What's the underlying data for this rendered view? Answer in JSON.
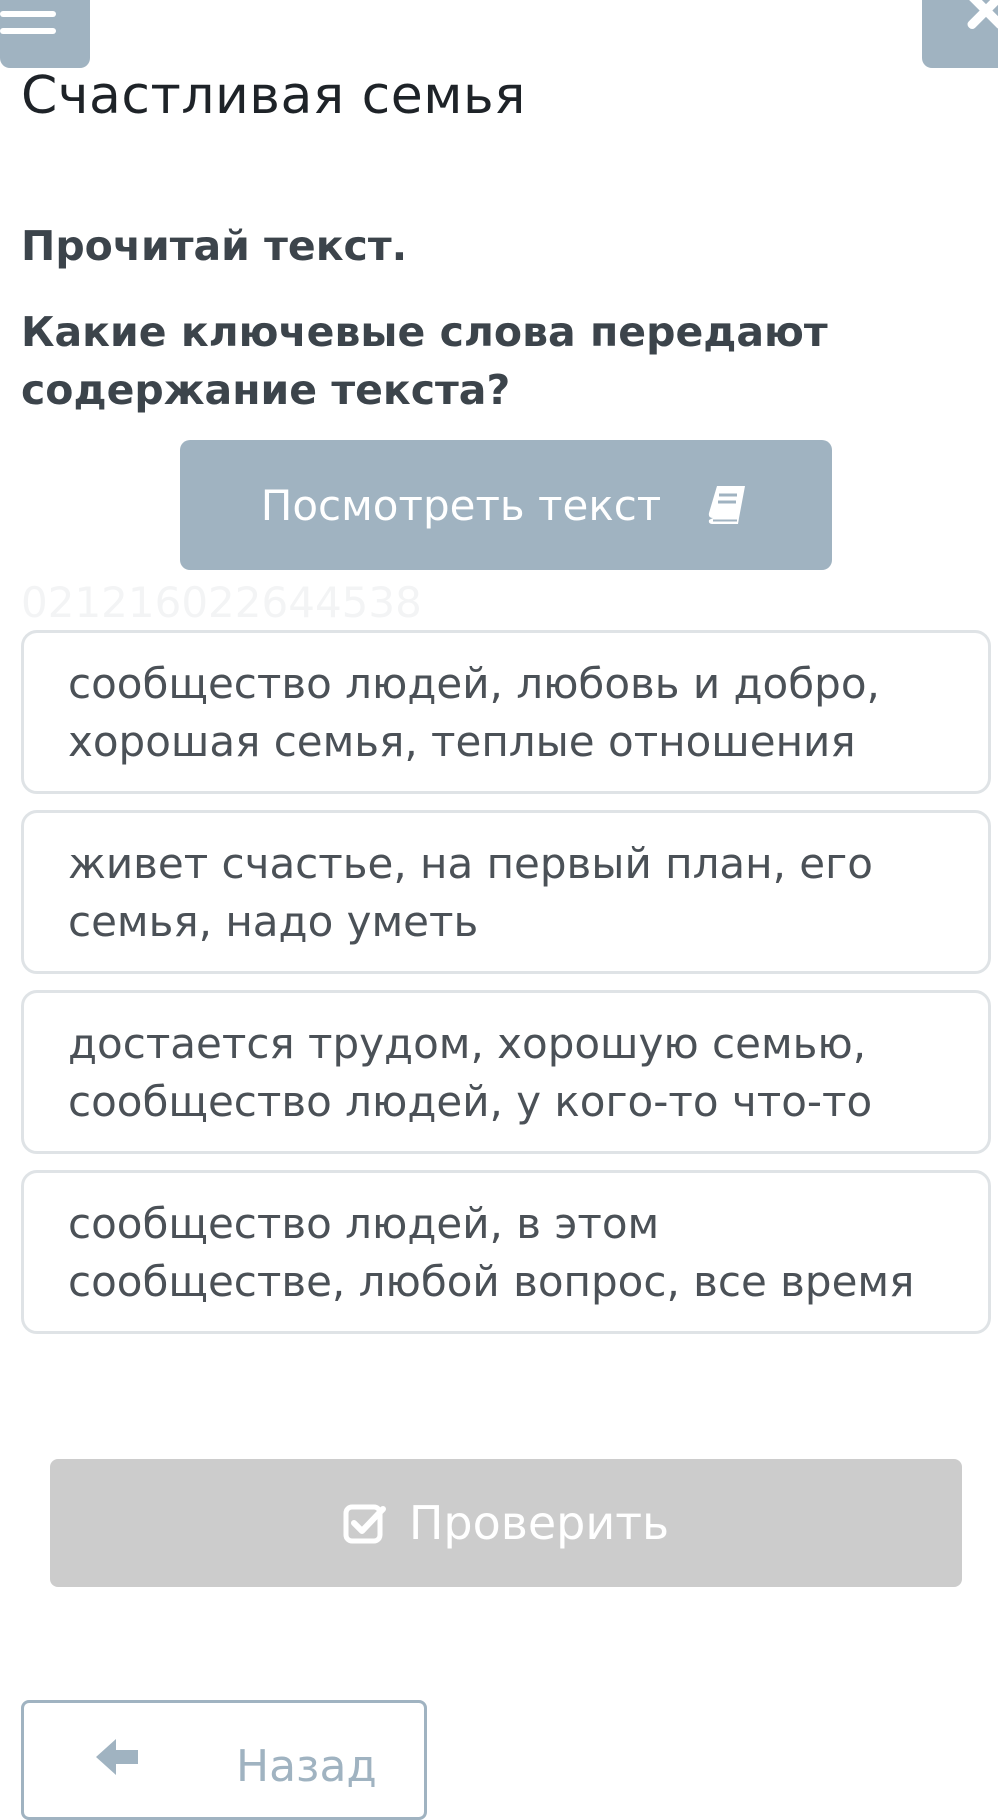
{
  "header": {
    "menu_icon": "hamburger-menu-icon",
    "close_icon": "close-icon",
    "title": "Счастливая семья"
  },
  "task": {
    "instruction": "Прочитай текст.",
    "question": "Какие ключевые слова передают содержание текста?",
    "view_text_label": "Посмотреть текст",
    "view_text_icon": "book-icon",
    "watermark": "021216022644538"
  },
  "options": [
    {
      "text": "сообщество людей, любовь и добро, хорошая семья, теплые отношения"
    },
    {
      "text": "живет счастье, на первый план, его семья, надо уметь"
    },
    {
      "text": "достается трудом, хорошую семью, сообщество людей, у кого-то что-то"
    },
    {
      "text": "сообщество людей, в этом сообществе, любой вопрос, все время"
    }
  ],
  "footer": {
    "check_label": "Проверить",
    "check_icon": "checkbox-check-icon",
    "back_label": "Назад",
    "back_icon": "arrow-left-icon"
  },
  "colors": {
    "accent": "#a0b3c1",
    "disabled": "#cccccc",
    "option_border": "#dfe3e6",
    "text": "#3c444b"
  }
}
